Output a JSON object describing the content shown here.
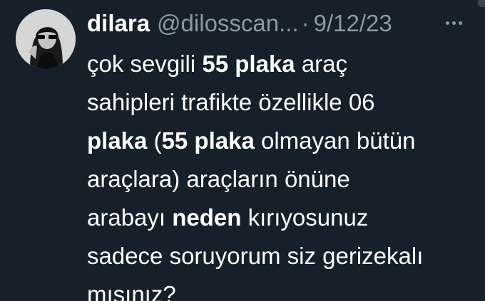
{
  "author": {
    "display_name": "dilara",
    "handle": "@dilosscan...",
    "separator": "·",
    "date": "9/12/23"
  },
  "tweet": {
    "lines": [
      [
        {
          "t": "çok sevgili ",
          "b": false
        },
        {
          "t": "55 plaka",
          "b": true
        },
        {
          "t": " araç",
          "b": false
        }
      ],
      [
        {
          "t": "sahipleri trafikte özellikle 06",
          "b": false
        }
      ],
      [
        {
          "t": "plaka",
          "b": true
        },
        {
          "t": " (",
          "b": false
        },
        {
          "t": "55 plaka",
          "b": true
        },
        {
          "t": " olmayan bütün",
          "b": false
        }
      ],
      [
        {
          "t": "araçlara) araçların önüne",
          "b": false
        }
      ],
      [
        {
          "t": "arabayı ",
          "b": false
        },
        {
          "t": "neden",
          "b": true
        },
        {
          "t": " kırıyosunuz",
          "b": false
        }
      ],
      [
        {
          "t": "sadece soruyorum siz gerizekalı",
          "b": false
        }
      ],
      [
        {
          "t": "mısınız?",
          "b": false
        }
      ]
    ]
  },
  "icons": {
    "more": "more-horizontal-icon",
    "avatar": "profile-photo"
  },
  "colors": {
    "background": "#15202b",
    "text_primary": "#ffffff",
    "text_secondary": "#8b98a5"
  }
}
